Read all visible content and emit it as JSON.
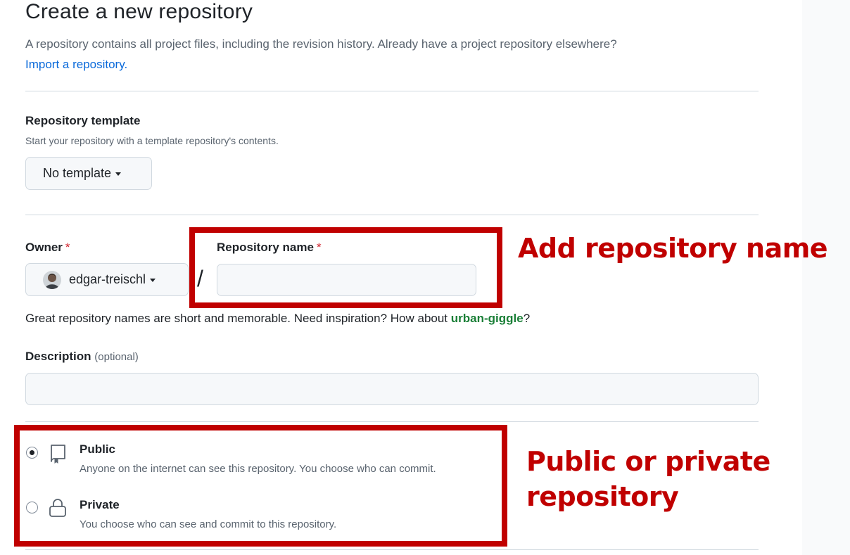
{
  "header": {
    "title": "Create a new repository",
    "subtitle": "A repository contains all project files, including the revision history. Already have a project repository elsewhere?",
    "import_link": "Import a repository."
  },
  "template": {
    "label": "Repository template",
    "note": "Start your repository with a template repository's contents.",
    "selected": "No template"
  },
  "owner": {
    "label": "Owner",
    "required_mark": "*",
    "selected": "edgar-treischl"
  },
  "separator": "/",
  "repo_name": {
    "label": "Repository name",
    "required_mark": "*",
    "value": ""
  },
  "name_hint": {
    "text": "Great repository names are short and memorable. Need inspiration? How about ",
    "suggestion": "urban-giggle",
    "suffix": "?"
  },
  "description": {
    "label": "Description",
    "optional": "(optional)",
    "value": ""
  },
  "visibility": {
    "selected": "public",
    "options": [
      {
        "id": "public",
        "title": "Public",
        "desc": "Anyone on the internet can see this repository. You choose who can commit.",
        "icon": "repo-icon"
      },
      {
        "id": "private",
        "title": "Private",
        "desc": "You choose who can see and commit to this repository.",
        "icon": "lock-icon"
      }
    ]
  },
  "annotations": {
    "name_callout": "Add repository name",
    "visibility_callout_line1": "Public or private",
    "visibility_callout_line2": "repository",
    "color": "#c00000"
  },
  "colors": {
    "link": "#0969da",
    "suggestion": "#1a7f37",
    "required": "#d1242f"
  }
}
